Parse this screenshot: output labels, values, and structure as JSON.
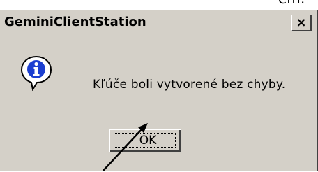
{
  "background_text": "em:",
  "dialog": {
    "title": "GeminiClientStation",
    "close_symbol": "×",
    "icon": "info-icon",
    "message": "Kľúče boli vytvorené bez chyby.",
    "ok_label": "OK"
  },
  "colors": {
    "dialog_face": "#d4d0c8",
    "icon_blue": "#1c3fd0",
    "text": "#000000"
  },
  "annotation": "cursor-arrow-icon"
}
